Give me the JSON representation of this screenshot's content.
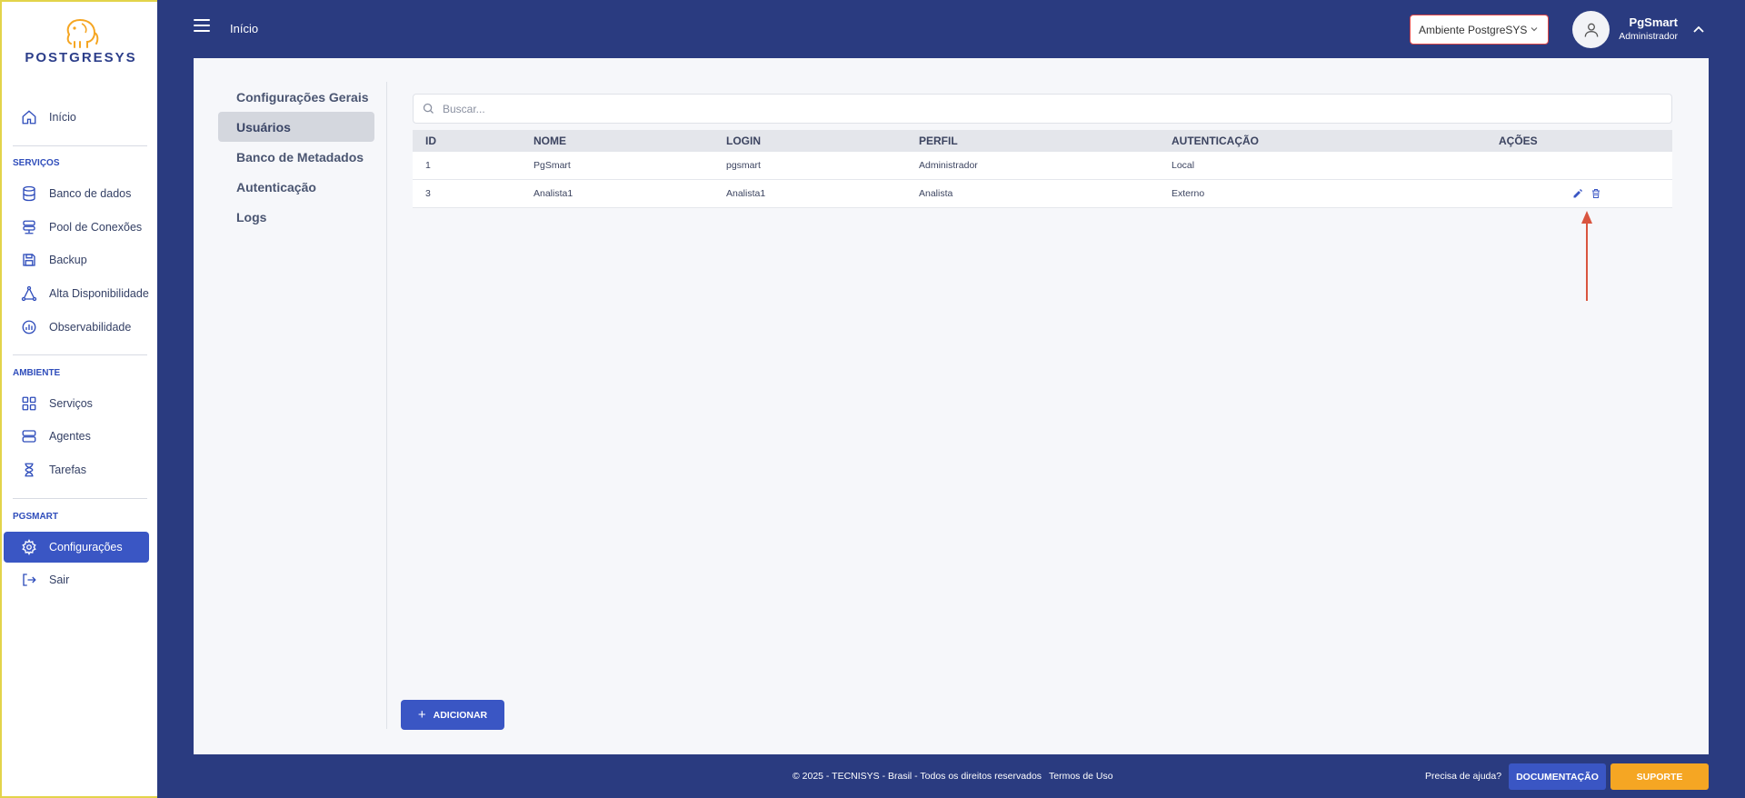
{
  "brand": {
    "name": "POSTGRESYS"
  },
  "sidebar": {
    "home": "Início",
    "sections": [
      {
        "title": "SERVIÇOS",
        "items": [
          "Banco de dados",
          "Pool de Conexões",
          "Backup",
          "Alta Disponibilidade",
          "Observabilidade"
        ]
      },
      {
        "title": "AMBIENTE",
        "items": [
          "Serviços",
          "Agentes",
          "Tarefas"
        ]
      },
      {
        "title": "PGSMART",
        "items": [
          "Configurações",
          "Sair"
        ]
      }
    ],
    "active_item": "Configurações"
  },
  "topbar": {
    "title": "Início",
    "environment": "Ambiente PostgreSYS",
    "user": {
      "name": "PgSmart",
      "role": "Administrador"
    }
  },
  "subnav": {
    "items": [
      "Configurações Gerais",
      "Usuários",
      "Banco de Metadados",
      "Autenticação",
      "Logs"
    ],
    "active": "Usuários"
  },
  "search": {
    "placeholder": "Buscar..."
  },
  "table": {
    "columns": [
      "ID",
      "NOME",
      "LOGIN",
      "PERFIL",
      "AUTENTICAÇÃO",
      "AÇÕES"
    ],
    "rows": [
      [
        "1",
        "PgSmart",
        "pgsmart",
        "Administrador",
        "Local"
      ],
      [
        "3",
        "Analista1",
        "Analista1",
        "Analista",
        "Externo"
      ]
    ]
  },
  "add_button": "ADICIONAR",
  "footer": {
    "copyright": "© 2025 - TECNISYS - Brasil - Todos os direitos reservados",
    "terms": "Termos de Uso",
    "help": "Precisa de ajuda?",
    "doc_button": "DOCUMENTAÇÃO",
    "support_button": "SUPORTE"
  },
  "colors": {
    "primary": "#3a56c4",
    "background": "#2a3b80",
    "accent": "#f5a623",
    "arrow": "#d9553f"
  }
}
